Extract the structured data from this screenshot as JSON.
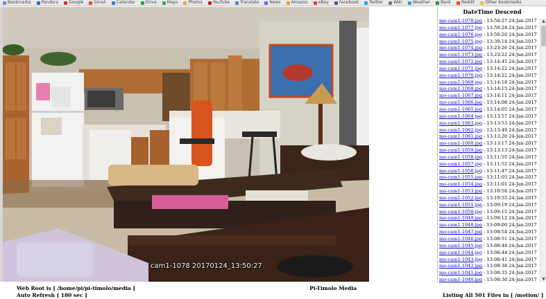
{
  "bookmarks": [
    {
      "label": "Bookmarks",
      "color": "#5b8fd6"
    },
    {
      "label": "Pandora",
      "color": "#2a66c9"
    },
    {
      "label": "Google",
      "color": "#d93025"
    },
    {
      "label": "Gmail",
      "color": "#e24a3a"
    },
    {
      "label": "Calendar",
      "color": "#2e7bd6"
    },
    {
      "label": "Drive",
      "color": "#22a35a"
    },
    {
      "label": "Maps",
      "color": "#37a44a"
    },
    {
      "label": "Photos",
      "color": "#f2a531"
    },
    {
      "label": "YouTube",
      "color": "#cc2020"
    },
    {
      "label": "Translate",
      "color": "#4a7ee0"
    },
    {
      "label": "News",
      "color": "#5a6ed6"
    },
    {
      "label": "Amazon",
      "color": "#f09a20"
    },
    {
      "label": "eBay",
      "color": "#e33a3a"
    },
    {
      "label": "Facebook",
      "color": "#3b5998"
    },
    {
      "label": "Twitter",
      "color": "#1da1f2"
    },
    {
      "label": "Wiki",
      "color": "#777777"
    },
    {
      "label": "Weather",
      "color": "#3b9cd6"
    },
    {
      "label": "Bank",
      "color": "#2b8a3e"
    },
    {
      "label": "Reddit",
      "color": "#ff4500"
    },
    {
      "label": "Other bookmarks",
      "color": "#f0c040"
    }
  ],
  "camera": {
    "camera_label": "cam1-1078",
    "timestamp": "20170124_13:50:27"
  },
  "list": {
    "title": "DateTime Descend",
    "files": [
      {
        "name": "mo-cam1-1078.jpg",
        "time": "13:50:27 24-Jan-2017"
      },
      {
        "name": "mo-cam1-1077.jpg",
        "time": "13:50:24 24-Jan-2017"
      },
      {
        "name": "mo-cam1-1076.jpg",
        "time": "13:50:20 24-Jan-2017"
      },
      {
        "name": "mo-cam1-1075.jpg",
        "time": "13:39:14 24-Jan-2017"
      },
      {
        "name": "mo-cam1-1074.jpg",
        "time": "13:23:26 24-Jan-2017"
      },
      {
        "name": "mo-cam1-1073.jpg",
        "time": "13:23:22 24-Jan-2017"
      },
      {
        "name": "mo-cam1-1072.jpg",
        "time": "13:14:45 24-Jan-2017"
      },
      {
        "name": "mo-cam1-1071.jpg",
        "time": "13:14:22 24-Jan-2017"
      },
      {
        "name": "mo-cam1-1070.jpg",
        "time": "13:14:22 24-Jan-2017"
      },
      {
        "name": "mo-cam1-1069.jpg",
        "time": "13:14:18 24-Jan-2017"
      },
      {
        "name": "mo-cam1-1068.jpg",
        "time": "13:14:15 24-Jan-2017"
      },
      {
        "name": "mo-cam1-1067.jpg",
        "time": "13:14:11 24-Jan-2017"
      },
      {
        "name": "mo-cam1-1066.jpg",
        "time": "13:14:08 24-Jan-2017"
      },
      {
        "name": "mo-cam1-1065.jpg",
        "time": "13:14:05 24-Jan-2017"
      },
      {
        "name": "mo-cam1-1064.jpg",
        "time": "13:13:57 24-Jan-2017"
      },
      {
        "name": "mo-cam1-1063.jpg",
        "time": "13:13:53 24-Jan-2017"
      },
      {
        "name": "mo-cam1-1062.jpg",
        "time": "13:13:49 24-Jan-2017"
      },
      {
        "name": "mo-cam1-1061.jpg",
        "time": "13:13:20 24-Jan-2017"
      },
      {
        "name": "mo-cam1-1060.jpg",
        "time": "13:13:17 24-Jan-2017"
      },
      {
        "name": "mo-cam1-1059.jpg",
        "time": "13:13:13 24-Jan-2017"
      },
      {
        "name": "mo-cam1-1058.jpg",
        "time": "13:11:55 24-Jan-2017"
      },
      {
        "name": "mo-cam1-1057.jpg",
        "time": "13:11:52 24-Jan-2017"
      },
      {
        "name": "mo-cam1-1056.jpg",
        "time": "13:11:47 24-Jan-2017"
      },
      {
        "name": "mo-cam1-1055.jpg",
        "time": "13:11:05 24-Jan-2017"
      },
      {
        "name": "mo-cam1-1054.jpg",
        "time": "13:11:01 24-Jan-2017"
      },
      {
        "name": "mo-cam1-1053.jpg",
        "time": "13:10:58 24-Jan-2017"
      },
      {
        "name": "mo-cam1-1052.jpg",
        "time": "13:10:55 24-Jan-2017"
      },
      {
        "name": "mo-cam1-1051.jpg",
        "time": "13:09:19 24-Jan-2017"
      },
      {
        "name": "mo-cam1-1050.jpg",
        "time": "13:09:15 24-Jan-2017"
      },
      {
        "name": "mo-cam1-1049.jpg",
        "time": "13:09:12 24-Jan-2017"
      },
      {
        "name": "mo-cam1-1048.jpg",
        "time": "13:09:00 24-Jan-2017"
      },
      {
        "name": "mo-cam1-1047.jpg",
        "time": "13:08:54 24-Jan-2017"
      },
      {
        "name": "mo-cam1-1046.jpg",
        "time": "13:08:51 24-Jan-2017"
      },
      {
        "name": "mo-cam1-1045.jpg",
        "time": "13:08:48 24-Jan-2017"
      },
      {
        "name": "mo-cam1-1044.jpg",
        "time": "13:08:44 24-Jan-2017"
      },
      {
        "name": "mo-cam1-1043.jpg",
        "time": "13:08:41 24-Jan-2017"
      },
      {
        "name": "mo-cam1-1042.jpg",
        "time": "13:08:38 24-Jan-2017"
      },
      {
        "name": "mo-cam1-1041.jpg",
        "time": "13:08:35 24-Jan-2017"
      },
      {
        "name": "mo-cam1-1040.jpg",
        "time": "13:08:30 24-Jan-2017"
      },
      {
        "name": "mo-cam1-1039.jpg",
        "time": "13:08:26 24-Jan-2017"
      },
      {
        "name": "mo-cam1-1038.jpg",
        "time": "13:08:23 24-Jan-2017"
      }
    ]
  },
  "footer": {
    "web_root": "Web Root is [ /home/pi/pi-timolo/media ]",
    "auto_refresh": "Auto Refresh [ 180 sec ]",
    "app_name": "Pi-Timolo Media",
    "listing": "Listing All 501 Files in [ /motion/ ]"
  }
}
